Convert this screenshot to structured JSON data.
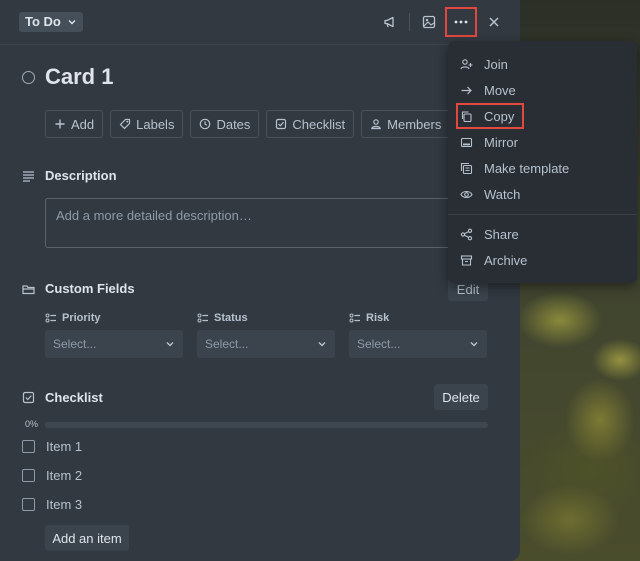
{
  "card": {
    "list_name": "To Do",
    "title": "Card 1",
    "actions": [
      {
        "label": "Add",
        "icon": "plus-icon"
      },
      {
        "label": "Labels",
        "icon": "tag-icon"
      },
      {
        "label": "Dates",
        "icon": "clock-icon"
      },
      {
        "label": "Checklist",
        "icon": "checkbox-icon"
      },
      {
        "label": "Members",
        "icon": "person-icon"
      }
    ],
    "description": {
      "heading": "Description",
      "placeholder": "Add a more detailed description…"
    },
    "custom_fields": {
      "heading": "Custom Fields",
      "edit_label": "Edit",
      "fields": [
        {
          "label": "Priority",
          "value": "Select..."
        },
        {
          "label": "Status",
          "value": "Select..."
        },
        {
          "label": "Risk",
          "value": "Select..."
        }
      ]
    },
    "checklist": {
      "heading": "Checklist",
      "delete_label": "Delete",
      "progress_text": "0%",
      "progress": 0,
      "items": [
        "Item 1",
        "Item 2",
        "Item 3"
      ],
      "add_label": "Add an item"
    }
  },
  "menu": {
    "items": [
      {
        "label": "Join",
        "icon": "person-plus-icon"
      },
      {
        "label": "Move",
        "icon": "arrow-right-icon"
      },
      {
        "label": "Copy",
        "icon": "copy-icon"
      },
      {
        "label": "Mirror",
        "icon": "mirror-icon"
      },
      {
        "label": "Make template",
        "icon": "template-icon"
      },
      {
        "label": "Watch",
        "icon": "eye-icon"
      },
      {
        "label": "Share",
        "icon": "share-icon"
      },
      {
        "label": "Archive",
        "icon": "archive-icon"
      }
    ]
  },
  "colors": {
    "card_bg": "#323940",
    "menu_bg": "#282e33",
    "highlight": "#e2483d",
    "text": "#b6c2cf"
  }
}
